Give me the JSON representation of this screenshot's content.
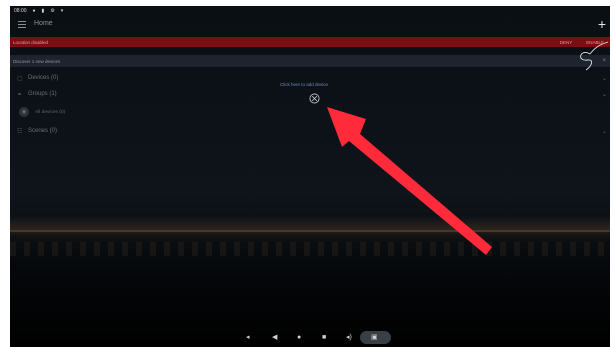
{
  "status_bar": {
    "time": "08:00",
    "icons": [
      "notification-icon",
      "media-icon",
      "settings-icon",
      "wifi-icon"
    ]
  },
  "app_bar": {
    "title": "Home",
    "menu_icon": "menu-icon",
    "add_icon": "plus-icon"
  },
  "warning_bar": {
    "text": "Location disabled",
    "actions": [
      "DENY",
      "ENABLE"
    ],
    "color": "#7a0e10"
  },
  "subheader": {
    "text": "Discover 1 new devices"
  },
  "sections": [
    {
      "label": "Devices (0)",
      "icon": "devices-icon"
    },
    {
      "label": "Groups (1)",
      "icon": "groups-icon"
    },
    {
      "label": "All devices (0)",
      "icon": "group-avatar",
      "sub": true
    },
    {
      "label": "Scenes (0)",
      "icon": "scenes-icon"
    }
  ],
  "center": {
    "prompt": "Click here to add device",
    "icon": "add-device-icon"
  },
  "annotation": {
    "arrow_color": "#ff2a3a",
    "signature": "handwritten-signature"
  },
  "nav_bar": {
    "icons": [
      "volume-down-icon",
      "back-icon",
      "home-icon",
      "recents-icon",
      "volume-up-icon",
      "screenshot-icon"
    ]
  }
}
